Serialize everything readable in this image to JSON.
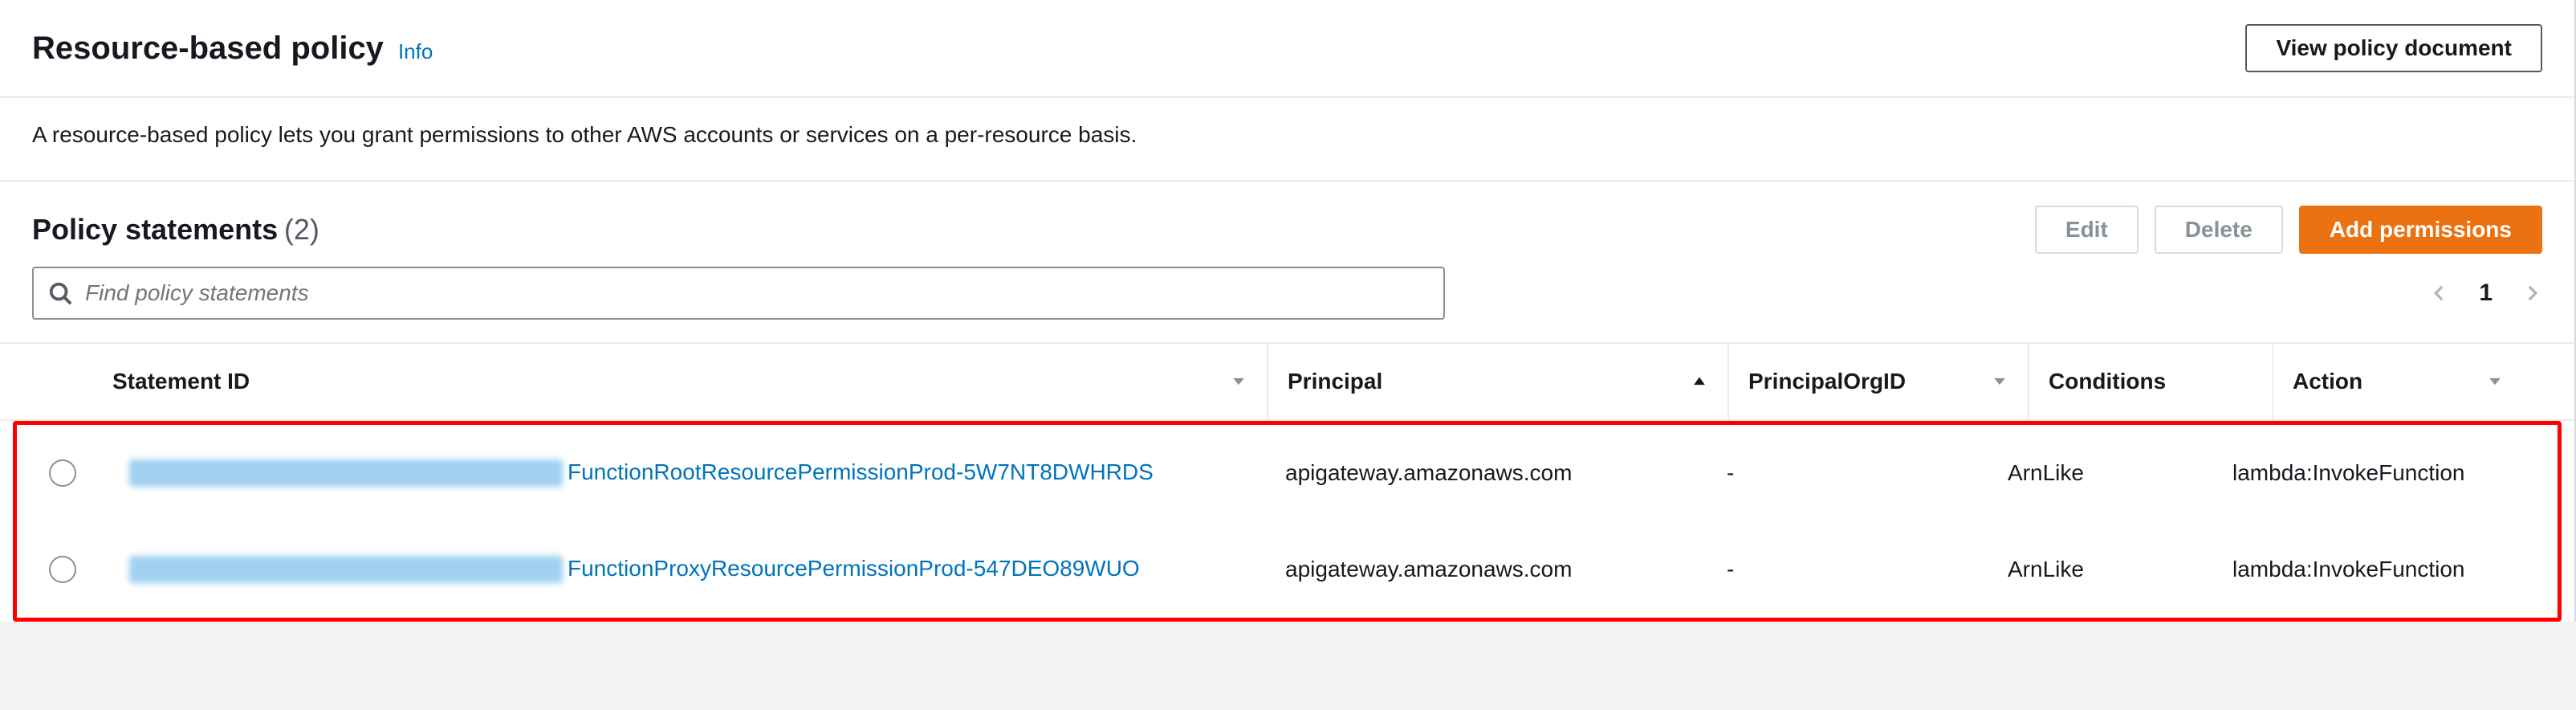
{
  "header": {
    "title": "Resource-based policy",
    "info": "Info",
    "view_btn": "View policy document"
  },
  "description": "A resource-based policy lets you grant permissions to other AWS accounts or services on a per-resource basis.",
  "statements": {
    "title": "Policy statements",
    "count": "(2)",
    "edit": "Edit",
    "delete": "Delete",
    "add": "Add permissions"
  },
  "search": {
    "placeholder": "Find policy statements"
  },
  "pagination": {
    "page": "1"
  },
  "columns": {
    "sid": "Statement ID",
    "principal": "Principal",
    "porg": "PrincipalOrgID",
    "conditions": "Conditions",
    "action": "Action"
  },
  "rows": [
    {
      "sid_suffix": "FunctionRootResourcePermissionProd-5W7NT8DWHRDS",
      "principal": "apigateway.amazonaws.com",
      "porg": "-",
      "conditions": "ArnLike",
      "action": "lambda:InvokeFunction"
    },
    {
      "sid_suffix": "FunctionProxyResourcePermissionProd-547DEO89WUO",
      "principal": "apigateway.amazonaws.com",
      "porg": "-",
      "conditions": "ArnLike",
      "action": "lambda:InvokeFunction"
    }
  ]
}
